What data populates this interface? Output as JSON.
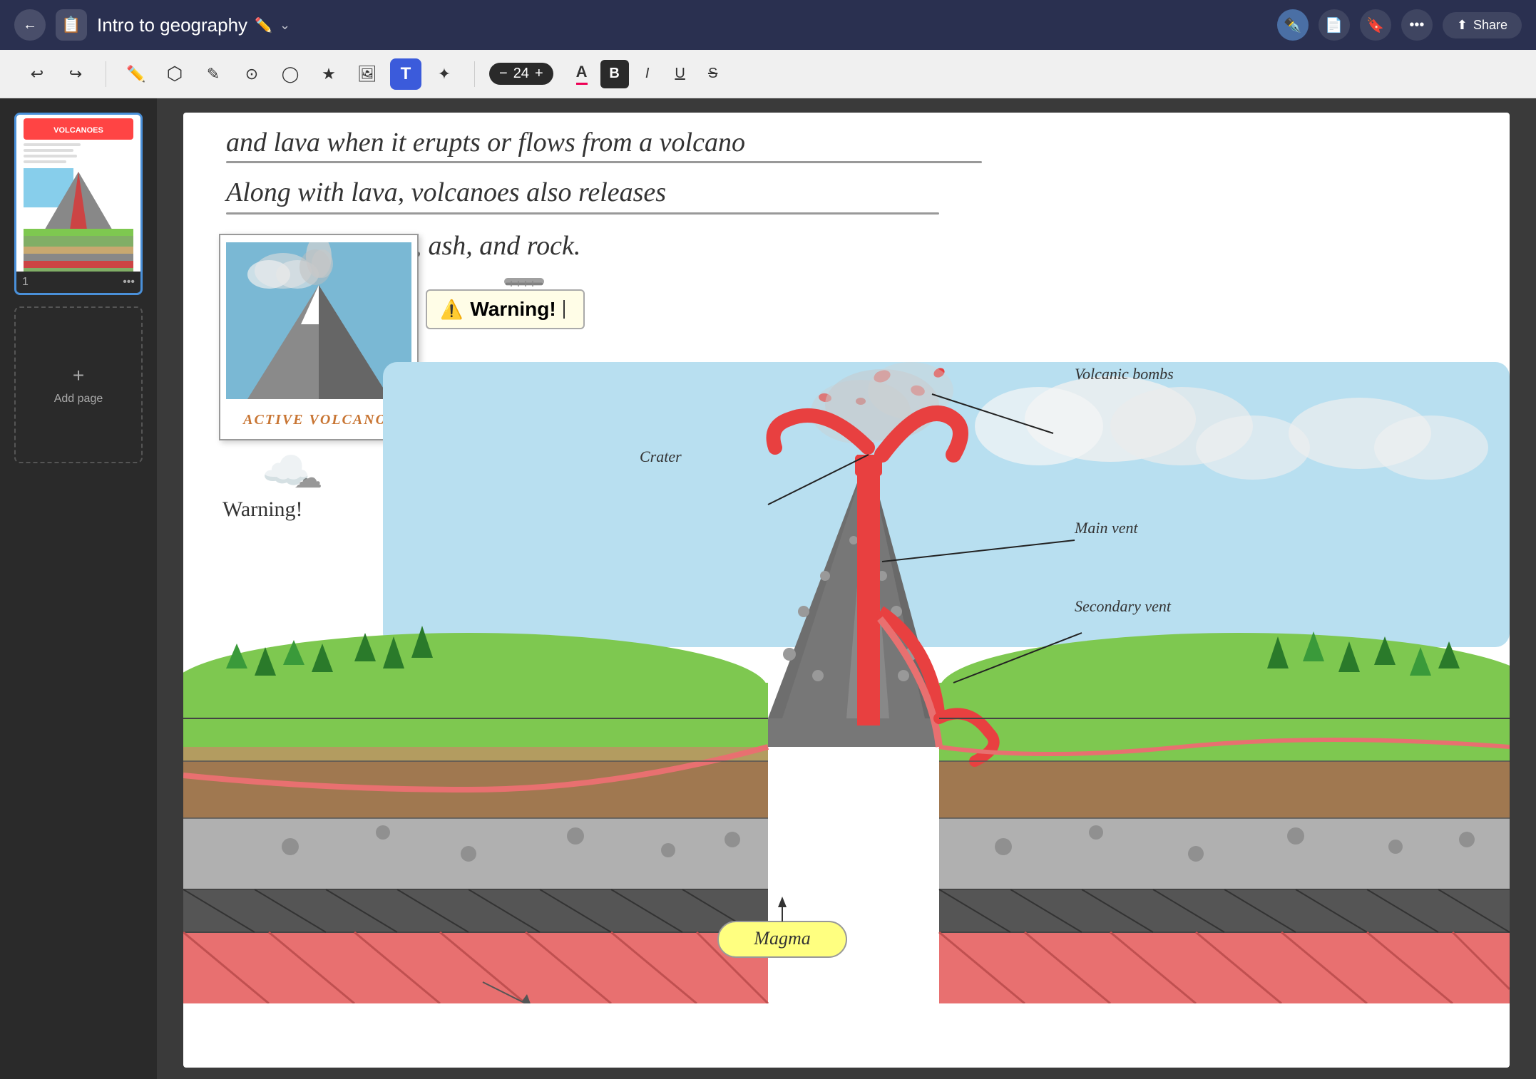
{
  "header": {
    "back_label": "←",
    "notebook_icon": "📋",
    "title": "Intro to geography",
    "title_pencil": "✏️",
    "title_chevron": "⌄",
    "pen_icon": "✒️",
    "add_page_icon": "📄",
    "bookmark_icon": "🔖",
    "more_icon": "•••",
    "share_icon": "⬆",
    "share_label": "Share"
  },
  "toolbar": {
    "undo_label": "↩",
    "redo_label": "↪",
    "pen_tool": "✏️",
    "eraser_tool": "◻",
    "pencil_tool": "✎",
    "lasso_tool": "⬡",
    "shape_tool": "⬤",
    "star_tool": "★",
    "image_tool": "🖼",
    "text_tool": "T",
    "marker_tool": "✦",
    "font_size_minus": "−",
    "font_size_value": "24",
    "font_size_plus": "+",
    "font_letter": "A",
    "bold_label": "B",
    "italic_label": "I",
    "underline_label": "U",
    "strikethrough_label": "S"
  },
  "canvas": {
    "line1": "and lava when it erupts or flows from a volcano",
    "line2": "Along with lava, volcanoes also releases",
    "line3": "gases, ash, and rock.",
    "warning_emoji": "⚠️",
    "warning_text": "Warning!",
    "photo_label": "ACTIVE VOLCANO!",
    "warning_below": "Warning!",
    "label_volcanic_bombs": "Volcanic bombs",
    "label_crater": "Crater",
    "label_main_vent": "Main vent",
    "label_secondary_vent": "Secondary vent",
    "label_magma": "Magma"
  },
  "sidebar": {
    "page_number": "1",
    "more_icon": "•••",
    "add_page_plus": "+",
    "add_page_label": "Add page"
  },
  "colors": {
    "header_bg": "#2a3050",
    "toolbar_bg": "#f0f0f0",
    "sidebar_bg": "#2a2a2a",
    "canvas_bg": "#ffffff",
    "active_tool_bg": "#3b5bdb",
    "lava_color": "#e8363a",
    "grass_color": "#7ec850",
    "sky_color": "#b8dff0"
  }
}
